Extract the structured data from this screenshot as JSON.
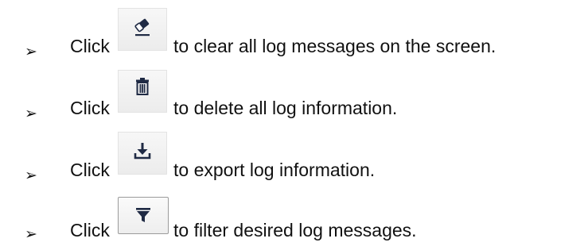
{
  "instructions": [
    {
      "bullet": "➢",
      "click_label": "Click",
      "icon": "eraser-icon",
      "action": "clear-log",
      "description": "to clear all log messages on the screen."
    },
    {
      "bullet": "➢",
      "click_label": "Click",
      "icon": "trash-icon",
      "action": "delete-log",
      "description": "to delete all log information."
    },
    {
      "bullet": "➢",
      "click_label": "Click",
      "icon": "download-icon",
      "action": "export-log",
      "description": "to export log information."
    },
    {
      "bullet": "➢",
      "click_label": "Click",
      "icon": "filter-icon",
      "action": "filter-log",
      "description": "to filter desired log messages."
    }
  ],
  "colors": {
    "text": "#111111",
    "icon": "#1f2a44",
    "button_bg": "#f2f2f2",
    "button_border": "#9b9b9b"
  }
}
